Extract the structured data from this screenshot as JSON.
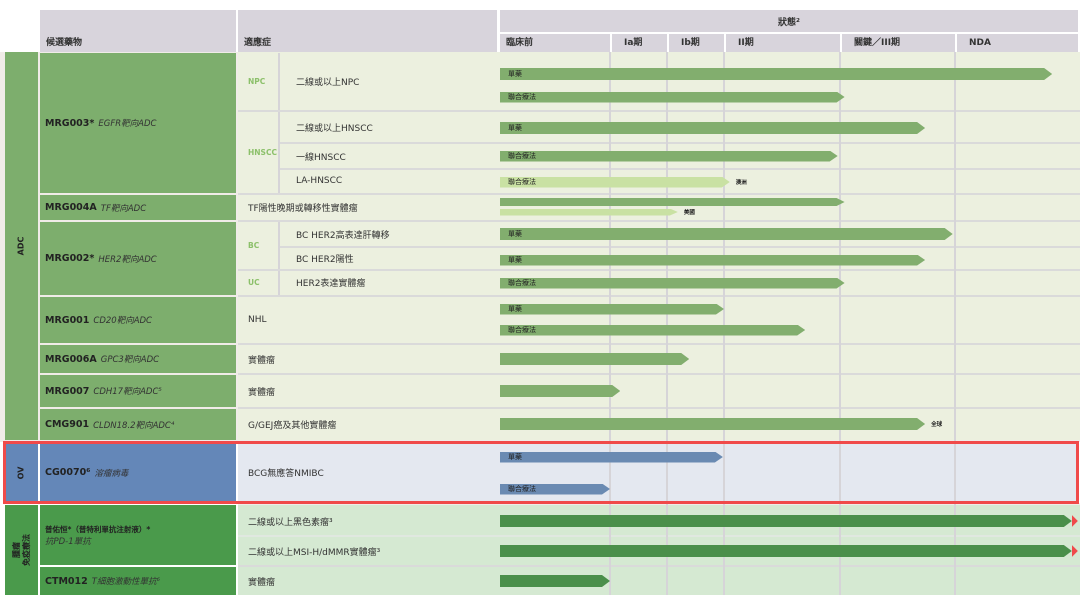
{
  "header": {
    "candidate": "候選藥物",
    "indication": "適應症",
    "status": "狀態²",
    "phases": [
      "臨床前",
      "Ia期",
      "Ib期",
      "II期",
      "關鍵／III期",
      "NDA"
    ]
  },
  "colors": {
    "adc_drug": "#7dae6d",
    "adc_bg": "#ecf0df",
    "ov_drug": "#6487b8",
    "ov_bg": "#e4e8f0",
    "io_drug": "#4a9a4b",
    "io_bg": "#d5e9d2",
    "bar_green": "#82ae6e",
    "bar_light": "#c9e1a3",
    "bar_blue": "#6a8ab2",
    "bar_dark": "#4a8f4a",
    "highlight": "#f04a4a",
    "header": "#d8d4dc"
  },
  "categories": [
    {
      "label": "ADC"
    },
    {
      "label": "OV"
    },
    {
      "label": "腫瘤\n免疫療法"
    }
  ],
  "drugs": [
    {
      "name": "MRG003*",
      "target": "EGFR靶向ADC"
    },
    {
      "name": "MRG004A",
      "target": "TF靶向ADC"
    },
    {
      "name": "MRG002*",
      "target": "HER2靶向ADC"
    },
    {
      "name": "MRG001",
      "target": "CD20靶向ADC"
    },
    {
      "name": "MRG006A",
      "target": "GPC3靶向ADC"
    },
    {
      "name": "MRG007",
      "target": "CDH17靶向ADC⁵"
    },
    {
      "name": "CMG901",
      "target": "CLDN18.2靶向ADC⁴"
    },
    {
      "name": "CG0070⁶",
      "target": "溶瘤病毒"
    },
    {
      "name": "普佑恒*（普特利單抗注射液）*",
      "target": "抗PD-1單抗"
    },
    {
      "name": "CTM012",
      "target": "T細胞激動性單抗⁶"
    }
  ],
  "groups": [
    "NPC",
    "HNSCC",
    "BC",
    "UC"
  ],
  "indications": [
    "二線或以上NPC",
    "二線或以上HNSCC",
    "一線HNSCC",
    "LA-HNSCC",
    "TF陽性晚期或轉移性實體瘤",
    "BC HER2高表達肝轉移",
    "BC HER2陽性",
    "HER2表達實體瘤",
    "NHL",
    "實體瘤",
    "實體瘤",
    "G/GEJ癌及其他實體瘤",
    "BCG無應答NMIBC",
    "二線或以上黑色素瘤³",
    "二線或以上MSI-H/dMMR實體瘤³",
    "實體瘤"
  ],
  "bars": [
    {
      "label": "單藥",
      "progress": 5.79,
      "color": "bar_green"
    },
    {
      "label": "聯合療法",
      "progress": 4.04,
      "color": "bar_green"
    },
    {
      "label": "單藥",
      "progress": 4.74,
      "color": "bar_green"
    },
    {
      "label": "聯合療法",
      "progress": 3.98,
      "color": "bar_green"
    },
    {
      "label": "聯合療法",
      "progress": 3.05,
      "color": "bar_light",
      "tag": "澳洲"
    },
    {
      "label": "",
      "progress": 4.04,
      "color": "bar_green"
    },
    {
      "label": "",
      "progress": 2.19,
      "color": "bar_light",
      "tag": "美國"
    },
    {
      "label": "單藥",
      "progress": 4.98,
      "color": "bar_green"
    },
    {
      "label": "單藥",
      "progress": 4.74,
      "color": "bar_green"
    },
    {
      "label": "聯合療法",
      "progress": 4.04,
      "color": "bar_green"
    },
    {
      "label": "單藥",
      "progress": 3.0,
      "color": "bar_green"
    },
    {
      "label": "聯合療法",
      "progress": 3.7,
      "color": "bar_green"
    },
    {
      "label": "",
      "progress": 2.39,
      "color": "bar_green"
    },
    {
      "label": "",
      "progress": 1.18,
      "color": "bar_green"
    },
    {
      "label": "",
      "progress": 4.74,
      "color": "bar_green",
      "tag": "全球"
    },
    {
      "label": "單藥",
      "progress": 2.98,
      "color": "bar_blue"
    },
    {
      "label": "聯合療法",
      "progress": 1.0,
      "color": "bar_blue"
    },
    {
      "label": "",
      "progress": 5.95,
      "color": "bar_dark",
      "marketed": true
    },
    {
      "label": "",
      "progress": 5.95,
      "color": "bar_dark",
      "marketed": true
    },
    {
      "label": "",
      "progress": 1.0,
      "color": "bar_dark"
    }
  ]
}
